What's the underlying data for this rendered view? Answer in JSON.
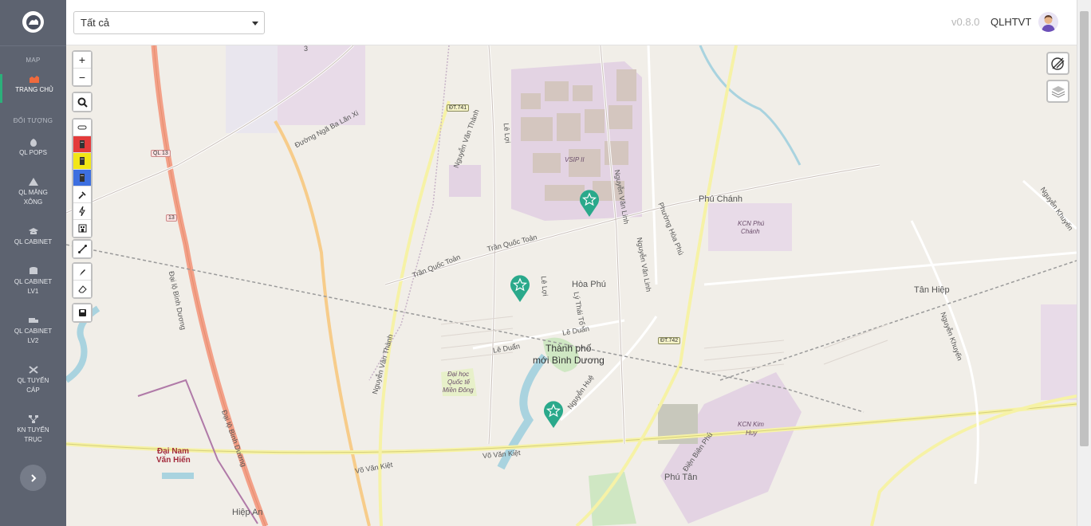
{
  "sidebar": {
    "map_section": "MAP",
    "home_label": "TRANG CHỦ",
    "objects_section": "ĐỐI TƯỢNG",
    "items": [
      {
        "label_1": "QL POPS",
        "label_2": ""
      },
      {
        "label_1": "QL MĂNG",
        "label_2": "XÔNG"
      },
      {
        "label_1": "QL CABINET",
        "label_2": ""
      },
      {
        "label_1": "QL CABINET",
        "label_2": "LV1"
      },
      {
        "label_1": "QL CABINET",
        "label_2": "LV2"
      },
      {
        "label_1": "QL TUYẾN",
        "label_2": "CÁP"
      },
      {
        "label_1": "KN TUYẾN",
        "label_2": "TRỤC"
      }
    ]
  },
  "topbar": {
    "filter_value": "Tất cả",
    "version": "v0.8.0",
    "username": "QLHTVT"
  },
  "map_controls": {
    "zoom_in": "+",
    "zoom_out": "−"
  },
  "map_labels": {
    "city": "Thành phố",
    "city_2": "mới Bình Dương",
    "ward_hoa_phu": "Hòa Phú",
    "ward_phu_chanh": "Phú Chánh",
    "ward_tan_hiep": "Tân Hiệp",
    "ward_phu_tan": "Phú Tân",
    "ward_hiep_an": "Hiệp An",
    "vsip": "VSIP II",
    "kcn_phu_chanh_1": "KCN Phú",
    "kcn_phu_chanh_2": "Chánh",
    "kcn_kim_huy_1": "KCN Kim",
    "kcn_kim_huy_2": "Huy",
    "uni_1": "Đại học",
    "uni_2": "Quốc tế",
    "uni_3": "Miền Đông",
    "dai_nam_1": "Đại Nam",
    "dai_nam_2": "Văn Hiến",
    "road_tran_quoc_toan": "Trần Quốc Toản",
    "road_tran_quoc_toan_2": "Trần Quốc Toản",
    "road_le_duan": "Lê Duẩn",
    "road_le_duan_2": "Lê Duẩn",
    "road_vo_van_kiet": "Võ Văn Kiệt",
    "road_vo_van_kiet_2": "Võ Văn Kiệt",
    "road_nga_ba_lan_xi": "Đường Ngã Ba Lăn Xi",
    "road_nguyen_van_thanh": "Nguyễn Văn Thành",
    "road_nguyen_van_linh": "Nguyễn Văn Linh",
    "road_dai_lo_binh_duong": "Đại lộ Bình Dương",
    "road_le_loi": "Lê Lợi",
    "road_ly_thai_to": "Lý Thái Tổ",
    "road_nguyen_hue": "Nguyễn Huệ",
    "road_phuong_hoa_phu": "Phường Hòa Phú",
    "road_nguyen_khuyen": "Nguyễn Khuyến",
    "road_dien_bien_phu": "Điện Biên Phủ",
    "shield_dt741": "ĐT.741",
    "shield_ql13": "QL 13",
    "shield_13": "13",
    "shield_dt742": "ĐT.742",
    "num_3": "3"
  },
  "colors": {
    "sidebar_bg": "#5d6370",
    "accent_green": "#2cb07a",
    "home_icon": "#f06a3d",
    "marker": "#2aa98b"
  }
}
